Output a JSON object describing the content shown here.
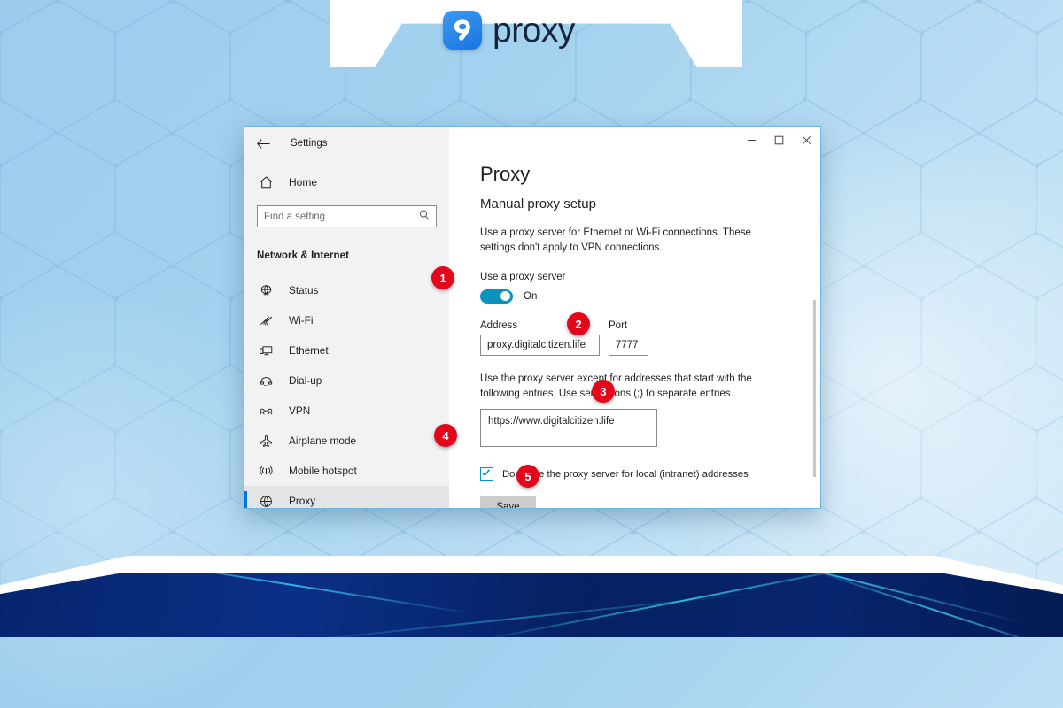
{
  "brand": {
    "name": "proxy",
    "mark_digit": "9",
    "mark_color": "#1a74e0"
  },
  "window": {
    "title": "Settings",
    "back_icon": "back-arrow-icon",
    "controls": {
      "minimize": "–",
      "maximize": "□",
      "close": "✕"
    }
  },
  "sidebar": {
    "home_label": "Home",
    "search": {
      "placeholder": "Find a setting",
      "value": ""
    },
    "category": "Network & Internet",
    "items": [
      {
        "label": "Status",
        "icon": "globe-status-icon",
        "selected": false
      },
      {
        "label": "Wi-Fi",
        "icon": "wifi-icon",
        "selected": false
      },
      {
        "label": "Ethernet",
        "icon": "ethernet-monitor-icon",
        "selected": false
      },
      {
        "label": "Dial-up",
        "icon": "dialup-phone-icon",
        "selected": false
      },
      {
        "label": "VPN",
        "icon": "vpn-icon",
        "selected": false
      },
      {
        "label": "Airplane mode",
        "icon": "airplane-icon",
        "selected": false
      },
      {
        "label": "Mobile hotspot",
        "icon": "hotspot-icon",
        "selected": false
      },
      {
        "label": "Proxy",
        "icon": "globe-icon",
        "selected": true
      }
    ]
  },
  "main": {
    "title": "Proxy",
    "subtitle": "Manual proxy setup",
    "description": "Use a proxy server for Ethernet or Wi-Fi connections. These settings don't apply to VPN connections.",
    "use_proxy_label": "Use a proxy server",
    "toggle_state": "On",
    "toggle_on": true,
    "address_label": "Address",
    "address_value": "proxy.digitalcitizen.life",
    "port_label": "Port",
    "port_value": "7777",
    "exceptions_description": "Use the proxy server except for addresses that start with the following entries. Use semicolons (;) to separate entries.",
    "exceptions_value": "https://www.digitalcitizen.life",
    "local_checkbox_label": "Don't use the proxy server for local (intranet) addresses",
    "local_checkbox_checked": true,
    "save_label": "Save"
  },
  "badges": [
    {
      "number": "1"
    },
    {
      "number": "2"
    },
    {
      "number": "3"
    },
    {
      "number": "4"
    },
    {
      "number": "5"
    }
  ],
  "colors": {
    "accent_blue": "#0078d7",
    "toggle_teal": "#0a93bd",
    "badge_red": "#e2071b",
    "background_blue": "#a3d2ef"
  }
}
